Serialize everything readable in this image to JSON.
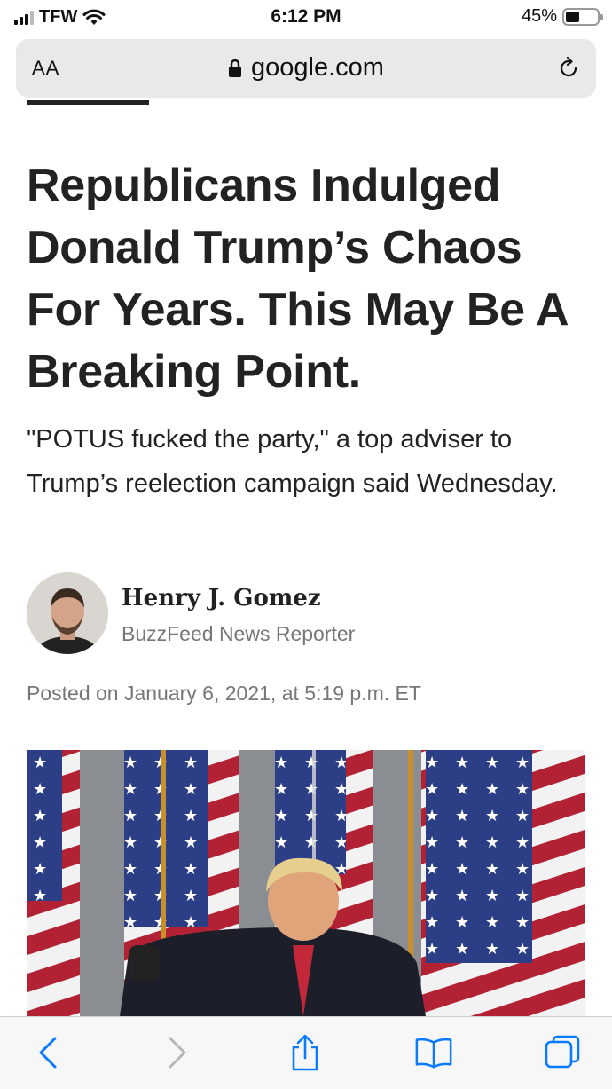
{
  "status_bar": {
    "carrier": "TFW",
    "time": "6:12 PM",
    "battery_percent": "45%",
    "battery_level": 0.45,
    "signal_icon": "cellular-signal-icon",
    "wifi_icon": "wifi-icon"
  },
  "browser": {
    "text_size_label": "AA",
    "url": "google.com",
    "lock_icon": "lock-icon",
    "reload_icon": "reload-icon"
  },
  "article": {
    "headline": "Republicans Indulged Donald Trump’s Chaos For Years. This May Be A Breaking Point.",
    "dek": "\"POTUS fucked the party,\" a top adviser to Trump’s reelection campaign said Wednesday.",
    "author": {
      "name": "Henry J. Gomez",
      "role": "BuzzFeed News Reporter"
    },
    "posted": "Posted on January 6, 2021, at 5:19 p.m. ET"
  },
  "toolbar": {
    "back_icon": "chevron-left-icon",
    "forward_icon": "chevron-right-icon",
    "share_icon": "share-icon",
    "bookmarks_icon": "book-icon",
    "tabs_icon": "tabs-icon"
  },
  "colors": {
    "accent": "#0a7aff",
    "text": "#222222",
    "muted": "#777777",
    "address_bar": "#e9e9eb"
  }
}
